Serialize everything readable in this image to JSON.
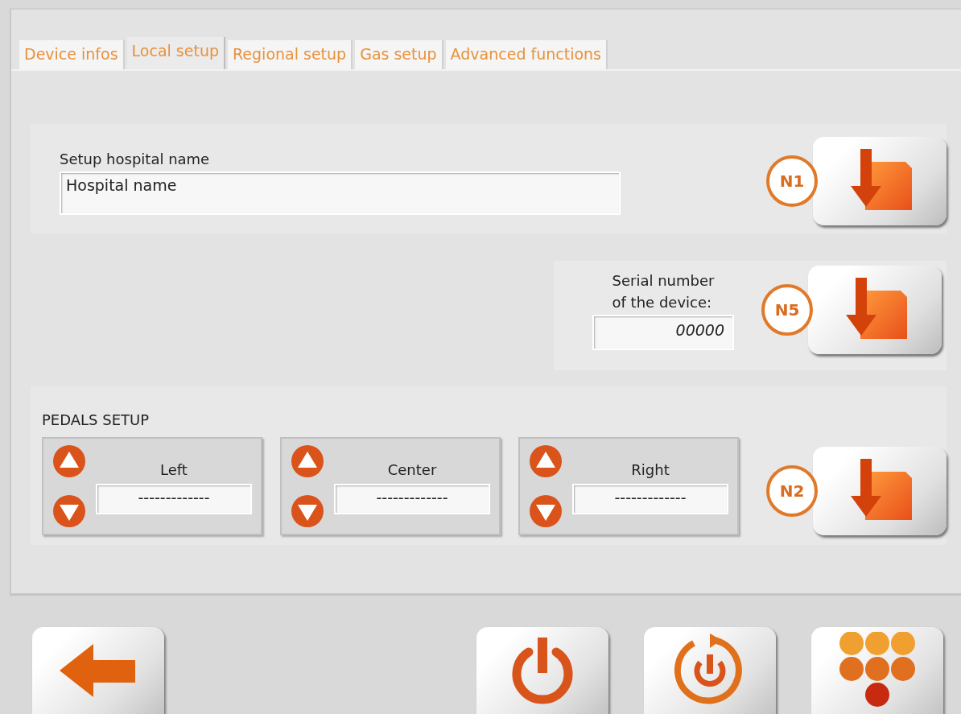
{
  "tabs": [
    {
      "label": "Device infos",
      "selected": false
    },
    {
      "label": "Local setup",
      "selected": true
    },
    {
      "label": "Regional setup",
      "selected": false
    },
    {
      "label": "Gas setup",
      "selected": false
    },
    {
      "label": "Advanced functions",
      "selected": false
    }
  ],
  "hospital": {
    "label": "Setup hospital name",
    "value": "Hospital name",
    "badge": "N1"
  },
  "serial": {
    "label": "Serial number\nof the device:",
    "value": "00000",
    "badge": "N5"
  },
  "pedals": {
    "title": "PEDALS SETUP",
    "badge": "N2",
    "items": [
      {
        "label": "Left",
        "value": "-------------"
      },
      {
        "label": "Center",
        "value": "-------------"
      },
      {
        "label": "Right",
        "value": "-------------"
      }
    ]
  },
  "bottom_buttons": [
    {
      "kind": "back"
    },
    {
      "kind": "spacer"
    },
    {
      "kind": "power"
    },
    {
      "kind": "restart"
    },
    {
      "kind": "keypad"
    }
  ]
}
